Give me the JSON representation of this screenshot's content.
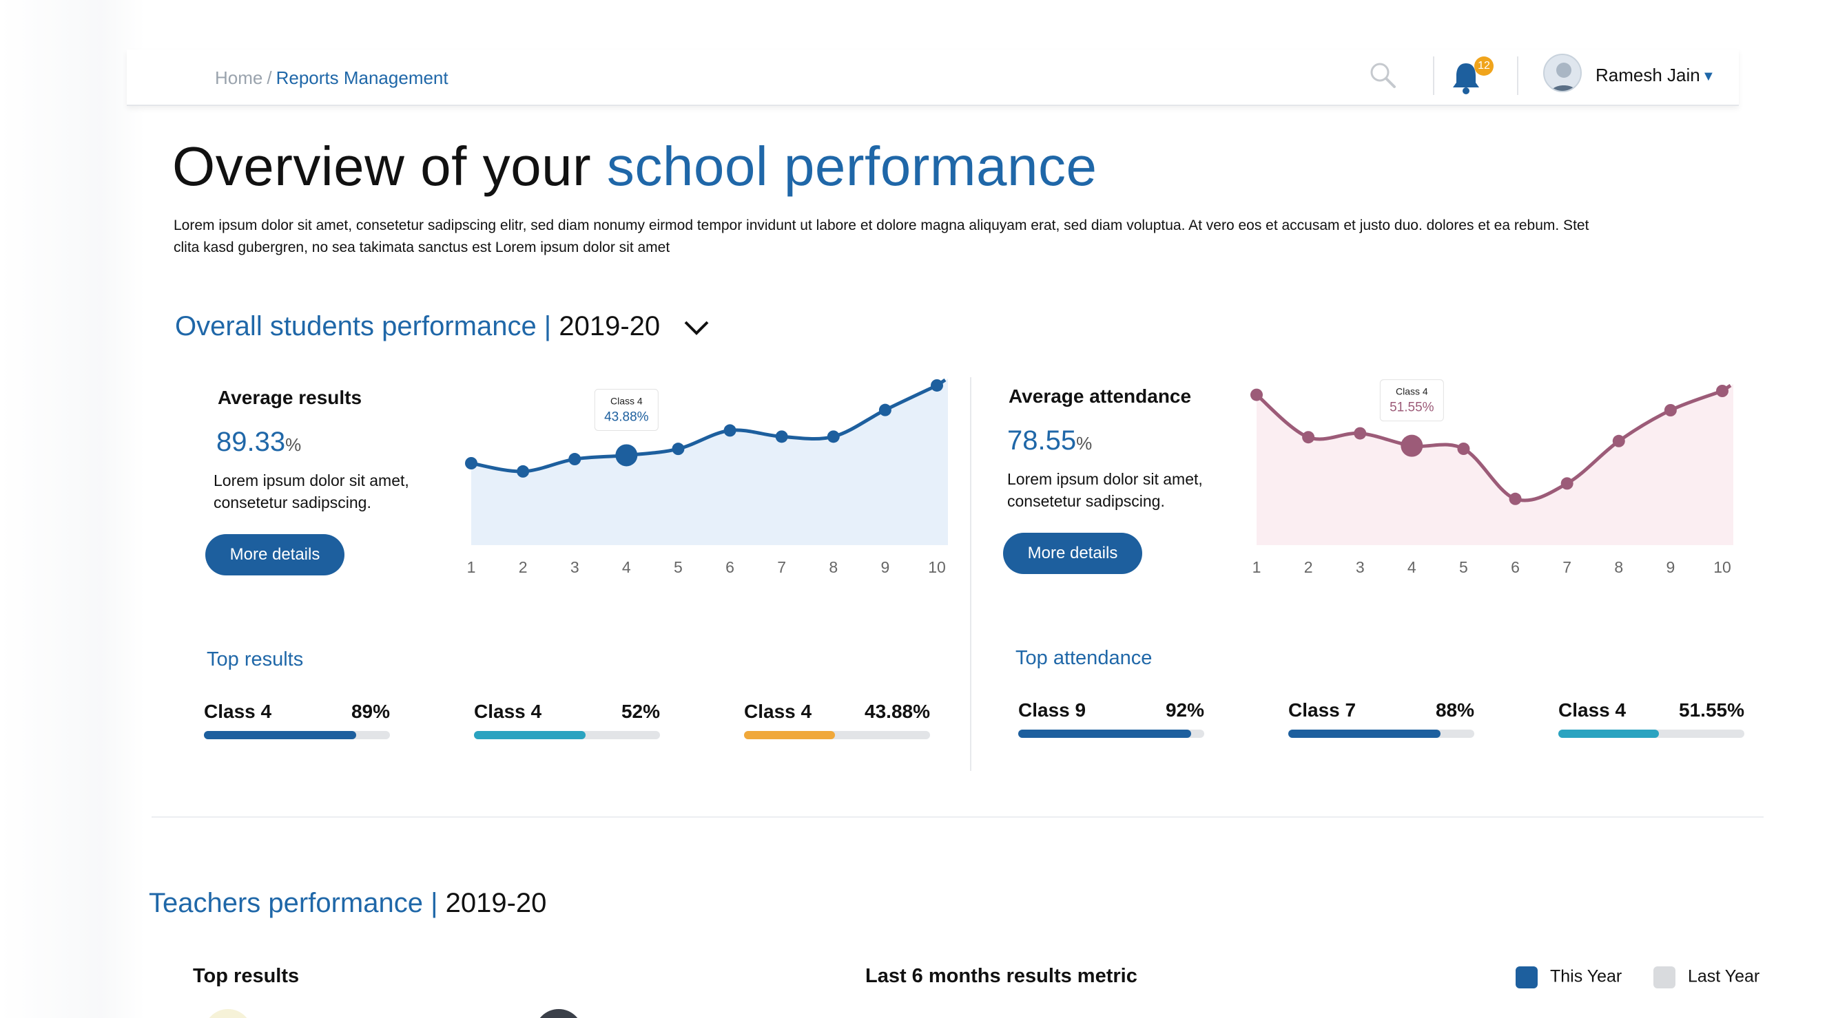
{
  "breadcrumb": {
    "home": "Home",
    "separator": "/",
    "current": "Reports Management"
  },
  "header": {
    "notifications_count": "12",
    "user_name": "Ramesh Jain"
  },
  "page": {
    "title_plain": "Overview of your ",
    "title_accent": "school performance",
    "intro": "Lorem ipsum dolor sit amet, consetetur sadipscing elitr, sed diam nonumy eirmod tempor invidunt ut labore et dolore magna aliquyam erat, sed diam voluptua. At vero eos et accusam et justo duo. dolores et ea rebum. Stet clita kasd gubergren, no sea takimata sanctus est Lorem ipsum dolor sit amet"
  },
  "students": {
    "heading": "Overall students performance |",
    "year": "2019-20",
    "results": {
      "title": "Average results",
      "value": "89.33",
      "unit": "%",
      "description": "Lorem ipsum dolor sit amet, consetetur sadipscing.",
      "button": "More details"
    },
    "attendance": {
      "title": "Average attendance",
      "value": "78.55",
      "unit": "%",
      "description": "Lorem ipsum dolor sit amet, consetetur sadipscing.",
      "button": "More details"
    },
    "top_results": {
      "heading": "Top results",
      "items": [
        {
          "name": "Class 4",
          "value": "89%",
          "fraction": 0.82,
          "color": "#1d5f9e"
        },
        {
          "name": "Class 4",
          "value": "52%",
          "fraction": 0.6,
          "color": "#2aa3c0"
        },
        {
          "name": "Class 4",
          "value": "43.88%",
          "fraction": 0.49,
          "color": "#f0a83a"
        }
      ]
    },
    "top_attendance": {
      "heading": "Top attendance",
      "items": [
        {
          "name": "Class 9",
          "value": "92%",
          "fraction": 0.93,
          "color": "#1d5f9e"
        },
        {
          "name": "Class 7",
          "value": "88%",
          "fraction": 0.82,
          "color": "#1d5f9e"
        },
        {
          "name": "Class 4",
          "value": "51.55%",
          "fraction": 0.54,
          "color": "#2aa3c0"
        }
      ]
    }
  },
  "teachers": {
    "heading": "Teachers performance |",
    "year": "2019-20",
    "top_results": "Top results",
    "metric_title": "Last 6 months results metric",
    "legend": [
      {
        "label": "This Year",
        "color": "#1d5f9e"
      },
      {
        "label": "Last Year",
        "color": "#d9dbde"
      }
    ]
  },
  "colors": {
    "accent": "#1f67a8",
    "results_line": "#1d5f9e",
    "attendance_line": "#9c5b78"
  },
  "chart_data": [
    {
      "type": "area",
      "title": "Average results",
      "x": [
        1,
        2,
        3,
        4,
        5,
        6,
        7,
        8,
        9,
        10
      ],
      "series": [
        {
          "values": [
            40,
            36,
            42,
            43.88,
            47,
            56,
            53,
            53,
            66,
            78
          ]
        }
      ],
      "ylim": [
        0,
        80
      ],
      "tooltip": {
        "x": 4,
        "label": "Class 4",
        "value": "43.88%"
      }
    },
    {
      "type": "area",
      "title": "Average attendance",
      "x": [
        1,
        2,
        3,
        4,
        5,
        6,
        7,
        8,
        9,
        10
      ],
      "series": [
        {
          "values": [
            78,
            56,
            58,
            51.55,
            50,
            24,
            32,
            54,
            70,
            80
          ]
        }
      ],
      "ylim": [
        0,
        85
      ],
      "tooltip": {
        "x": 4,
        "label": "Class 4",
        "value": "51.55%"
      }
    }
  ]
}
